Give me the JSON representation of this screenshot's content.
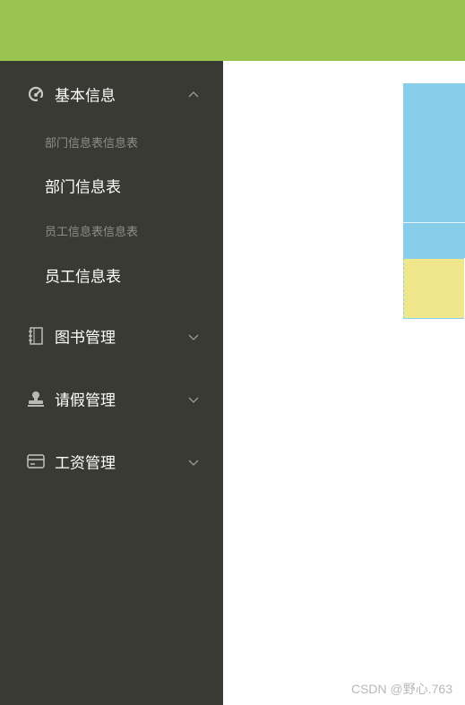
{
  "sidebar": {
    "menus": [
      {
        "label": "基本信息",
        "icon": "gauge-icon",
        "expanded": true,
        "groups": [
          {
            "title": "部门信息表信息表",
            "items": [
              {
                "label": "部门信息表"
              }
            ]
          },
          {
            "title": "员工信息表信息表",
            "items": [
              {
                "label": "员工信息表"
              }
            ]
          }
        ]
      },
      {
        "label": "图书管理",
        "icon": "notebook-icon",
        "expanded": false
      },
      {
        "label": "请假管理",
        "icon": "user-stamp-icon",
        "expanded": false
      },
      {
        "label": "工资管理",
        "icon": "credit-card-icon",
        "expanded": false
      }
    ]
  },
  "colors": {
    "topbar": "#99c450",
    "sidebar_bg": "#393a33",
    "panel_blue": "#87ceeb",
    "panel_yellow": "#f0e68c"
  },
  "watermark": "CSDN @野心.763"
}
